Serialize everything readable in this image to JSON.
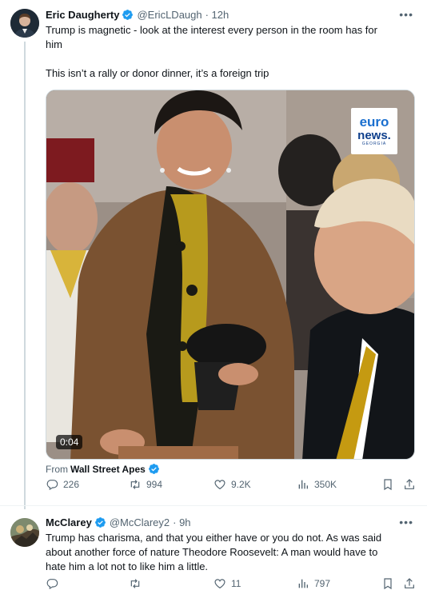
{
  "tweet1": {
    "name": "Eric Daugherty",
    "handle": "@EricLDaugh",
    "time": "· 12h",
    "text_line1": "Trump is magnetic - look at the interest every person in the room has for",
    "text_line2": "him",
    "text_line3": "This isn’t a rally or donor dinner, it’s a foreign trip",
    "video_duration": "0:04",
    "logo_line1": "euro",
    "logo_line2": "news.",
    "logo_line3": "GEORGIA",
    "from_label": "From",
    "from_account": "Wall Street Apes",
    "replies": "226",
    "reposts": "994",
    "likes": "9.2K",
    "views": "350K"
  },
  "tweet2": {
    "name": "McClarey",
    "handle": "@McClarey2",
    "time": "· 9h",
    "text_line1": "Trump has charisma, and that you either have or you do not.  As was said",
    "text_line2": "about another force of nature Theodore Roosevelt:  A man would have to",
    "text_line3": "hate him a lot not to like him a little.",
    "replies": "",
    "reposts": "",
    "likes": "11",
    "views": "797"
  },
  "more_icon": "•••",
  "colors": {
    "verified": "#1d9bf0",
    "muted": "#536471",
    "line": "#cfd9de"
  }
}
